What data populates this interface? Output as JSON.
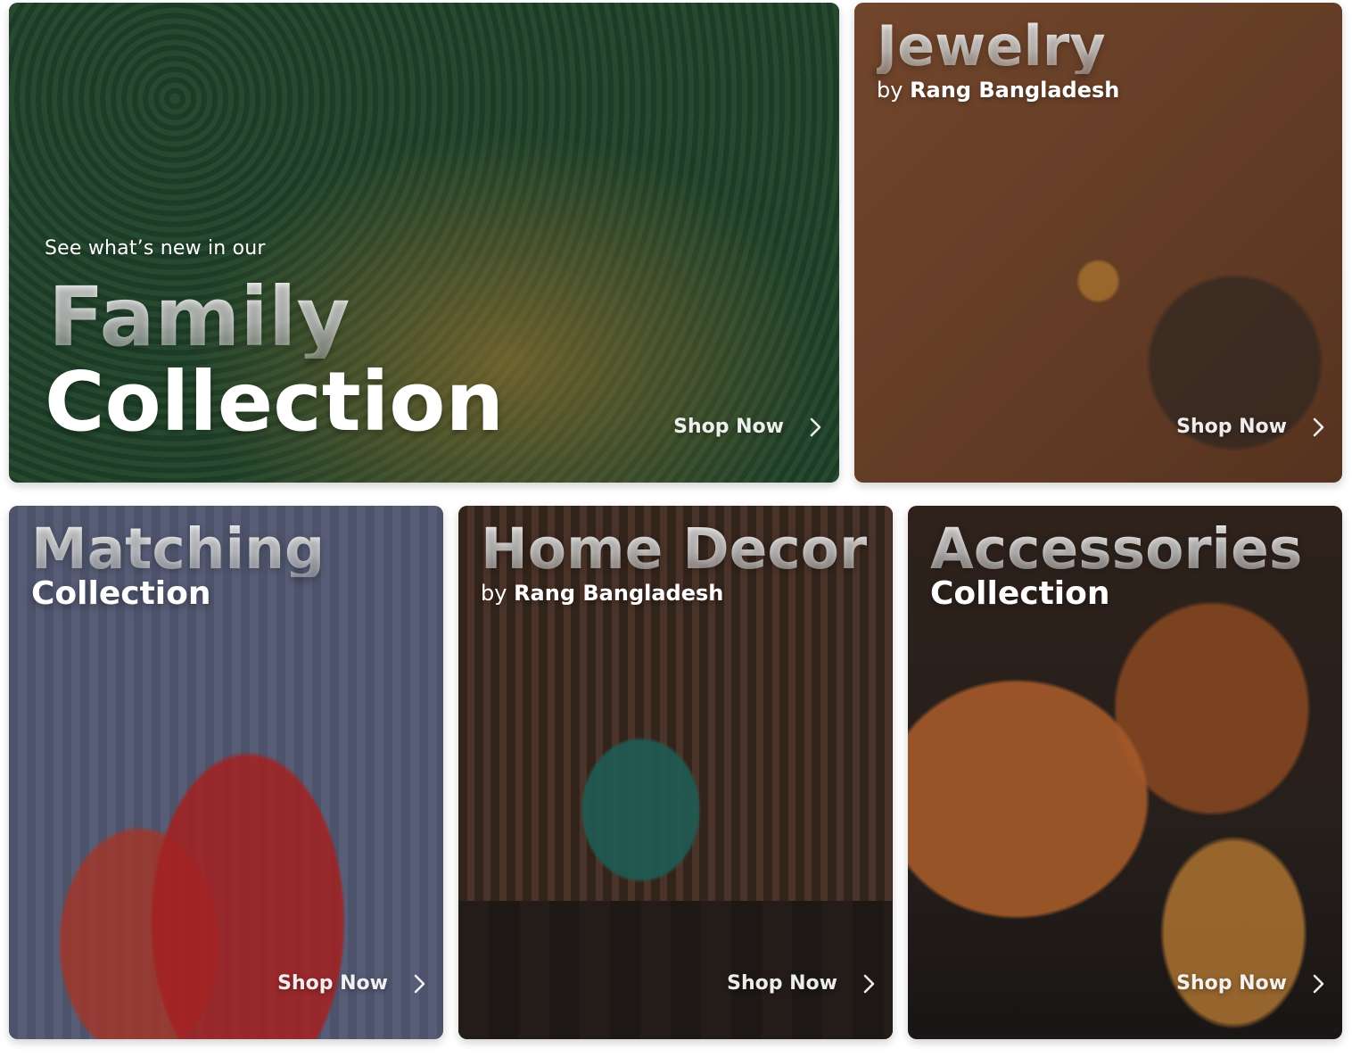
{
  "cards": {
    "family": {
      "kicker": "See what’s new in our",
      "title_line1": "Family",
      "title_line2": "Collection",
      "cta_label": "Shop Now"
    },
    "jewelry": {
      "title": "Jewelry",
      "byline_prefix": "by",
      "byline_brand": "Rang Bangladesh",
      "cta_label": "Shop Now"
    },
    "matching": {
      "title": "Matching",
      "subtitle": "Collection",
      "cta_label": "Shop Now"
    },
    "home_decor": {
      "title": "Home Decor",
      "byline_prefix": "by",
      "byline_brand": "Rang Bangladesh",
      "cta_label": "Shop Now"
    },
    "accessories": {
      "title": "Accessories",
      "subtitle": "Collection",
      "cta_label": "Shop Now"
    }
  },
  "icons": {
    "cta": "chevron-right-icon"
  },
  "colors": {
    "text": "#ffffff"
  }
}
